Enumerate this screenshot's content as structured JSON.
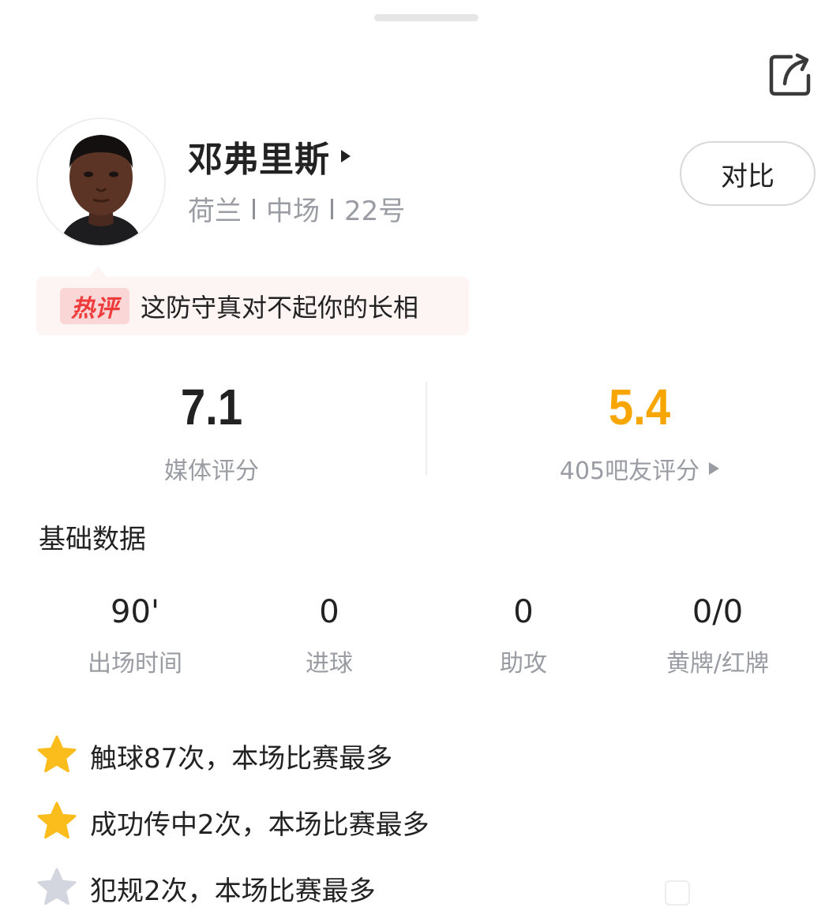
{
  "player": {
    "name": "邓弗里斯",
    "nationality": "荷兰",
    "position": "中场",
    "number": "22号",
    "avatar_icon": "player-headshot"
  },
  "actions": {
    "compare_label": "对比",
    "share_icon": "share-icon"
  },
  "hot_comment": {
    "tag": "热评",
    "text": "这防守真对不起你的长相"
  },
  "ratings": {
    "media": {
      "value": "7.1",
      "label": "媒体评分"
    },
    "fans": {
      "value": "5.4",
      "label": "405吧友评分",
      "color": "#f7a600"
    }
  },
  "basic_stats": {
    "title": "基础数据",
    "items": [
      {
        "value": "90'",
        "label": "出场时间"
      },
      {
        "value": "0",
        "label": "进球"
      },
      {
        "value": "0",
        "label": "助攻"
      },
      {
        "value": "0/0",
        "label": "黄牌/红牌"
      }
    ]
  },
  "highlights": [
    {
      "icon": "gold-star-icon",
      "text": "触球87次，本场比赛最多"
    },
    {
      "icon": "gold-star-icon",
      "text": "成功传中2次，本场比赛最多"
    },
    {
      "icon": "silver-star-icon",
      "text": "犯规2次，本场比赛最多"
    }
  ],
  "colors": {
    "accent_orange": "#f7a600",
    "hot_tag_red": "#ee3b3b",
    "muted_text": "#9a9ca3",
    "gold_star": "#fbbd1c",
    "silver_star": "#d3d6de"
  }
}
